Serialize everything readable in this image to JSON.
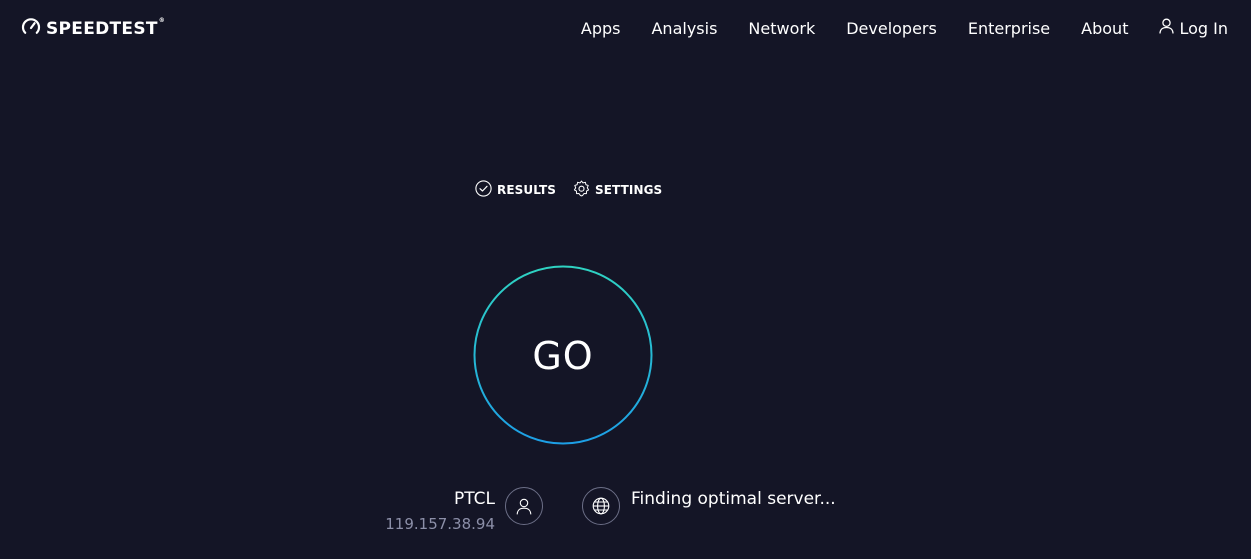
{
  "header": {
    "logo_text": "SPEEDTEST",
    "logo_tm": "®",
    "nav": [
      "Apps",
      "Analysis",
      "Network",
      "Developers",
      "Enterprise",
      "About"
    ],
    "login_label": "Log In"
  },
  "subnav": {
    "results_label": "RESULTS",
    "settings_label": "SETTINGS"
  },
  "go": {
    "label": "GO"
  },
  "isp": {
    "name": "PTCL",
    "ip": "119.157.38.94"
  },
  "server": {
    "status": "Finding optimal server..."
  },
  "colors": {
    "background": "#141526",
    "ring_start": "#2fd3c2",
    "ring_end": "#1d9fe6",
    "muted_text": "#8c8fa8"
  },
  "icons": {
    "logo": "gauge-icon",
    "login": "user-icon",
    "results": "check-circle-icon",
    "settings": "gear-icon",
    "isp": "user-icon",
    "server": "globe-icon"
  }
}
